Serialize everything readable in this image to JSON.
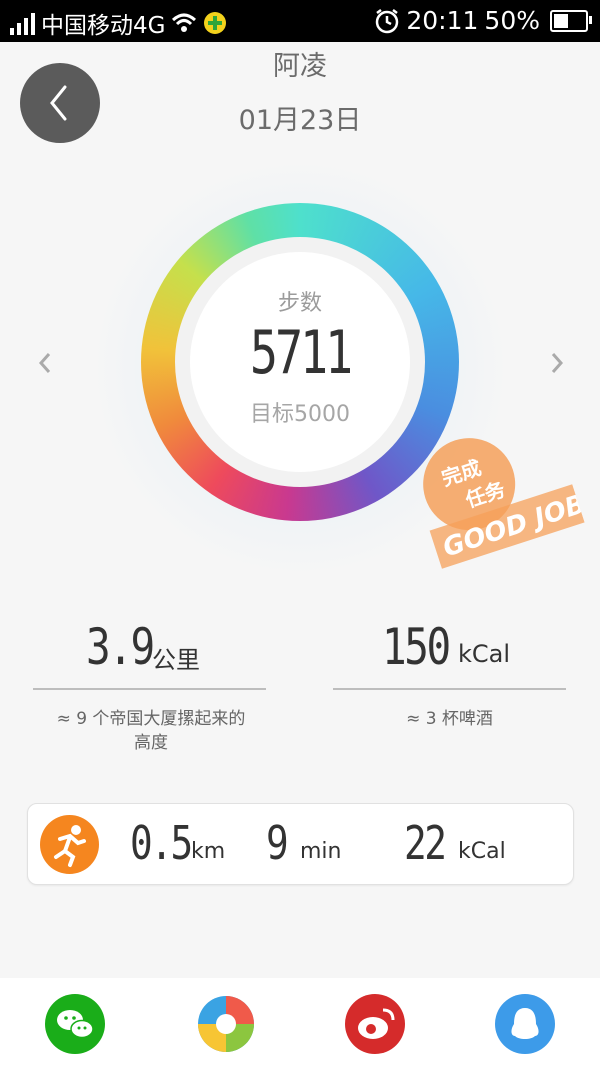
{
  "status_bar": {
    "carrier": "中国移动4G",
    "time": "20:11",
    "battery_pct_label": "50%",
    "battery_level": 0.5,
    "icons": [
      "signal-icon",
      "wifi-icon",
      "app-notification-icon",
      "alarm-icon",
      "battery-icon"
    ]
  },
  "header": {
    "title": "阿凌",
    "date": "01月23日",
    "back_icon": "back-arrow-icon"
  },
  "ring": {
    "label": "步数",
    "value": "5711",
    "goal_text": "目标5000",
    "progress": 1.0
  },
  "navigation": {
    "prev_icon": "chevron-left-icon",
    "next_icon": "chevron-right-icon"
  },
  "stamp": {
    "line1": "完成",
    "line2": "任务",
    "line3": "GOOD JOB",
    "color": "#f5a05a"
  },
  "stats": [
    {
      "value": "3.9",
      "unit": "公里",
      "note": "≈ 9  个帝国大厦摞起来的\n高度"
    },
    {
      "value": "150",
      "unit": "kCal",
      "note": "≈ 3 杯啤酒"
    }
  ],
  "activity_card": {
    "icon": "running-icon",
    "icon_color": "#f5861f",
    "distance_value": "0.5",
    "distance_unit": "km",
    "time_value": "9",
    "time_unit": "min",
    "calories_value": "22",
    "calories_unit": "kCal"
  },
  "share": [
    {
      "name": "wechat",
      "icon": "wechat-icon",
      "color": "#1aad19"
    },
    {
      "name": "camera",
      "icon": "aperture-icon",
      "color": "#ffffff"
    },
    {
      "name": "weibo",
      "icon": "weibo-icon",
      "color": "#d52b2b"
    },
    {
      "name": "qq",
      "icon": "qq-icon",
      "color": "#3d9be9"
    }
  ]
}
